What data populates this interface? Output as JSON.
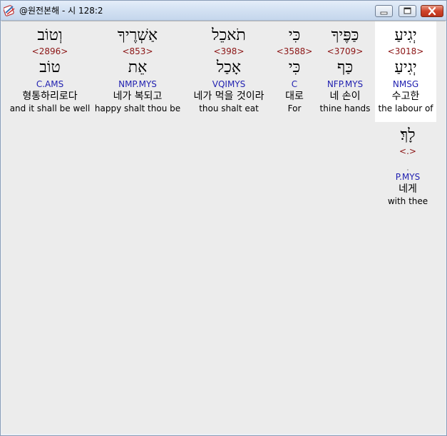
{
  "window": {
    "title": "@원전본해 - 시 128:2",
    "icons": {
      "app": "scroll-tool-icon",
      "minimize": "minimize-icon",
      "maximize": "maximize-icon",
      "close": "close-icon"
    },
    "colors": {
      "close_button": "#c7432a",
      "strong_number": "#8b1414",
      "morphology": "#1f1fb0"
    }
  },
  "words": [
    {
      "hebrew": "יְגִיעַ",
      "strong": "<3018>",
      "lemma": "יְגִיעַ",
      "morph": "NMSG",
      "korean": "수고한",
      "english": "the labour of",
      "selected": true
    },
    {
      "hebrew": "כַּפֶּיךָ",
      "strong": "<3709>",
      "lemma": "כַּף",
      "morph": "NFP.MYS",
      "korean": "네 손이",
      "english": "thine hands",
      "selected": false
    },
    {
      "hebrew": "כִּי",
      "strong": "<3588>",
      "lemma": "כִּי",
      "morph": "C",
      "korean": "대로",
      "english": "For",
      "selected": false
    },
    {
      "hebrew": "תֹאכֵל",
      "strong": "<398>",
      "lemma": "אָכַל",
      "morph": "VQIMYS",
      "korean": "네가 먹을 것이라",
      "english": "thou shalt eat",
      "selected": false
    },
    {
      "hebrew": "אַשְׁרֶיךָ",
      "strong": "<853>",
      "lemma": "אֵת",
      "morph": "NMP.MYS",
      "korean": "네가 복되고",
      "english": "happy shalt thou be",
      "selected": false
    },
    {
      "hebrew": "וְטוֹב",
      "strong": "<2896>",
      "lemma": "טוֹב",
      "morph": "C.AMS",
      "korean": "형통하리로다",
      "english": "and it shall be well",
      "selected": false
    },
    {
      "hebrew": "לָךְ׃",
      "strong": "<.>",
      "lemma": "ּ",
      "morph": "P.MYS",
      "korean": "네게",
      "english": "with thee",
      "selected": false
    }
  ]
}
